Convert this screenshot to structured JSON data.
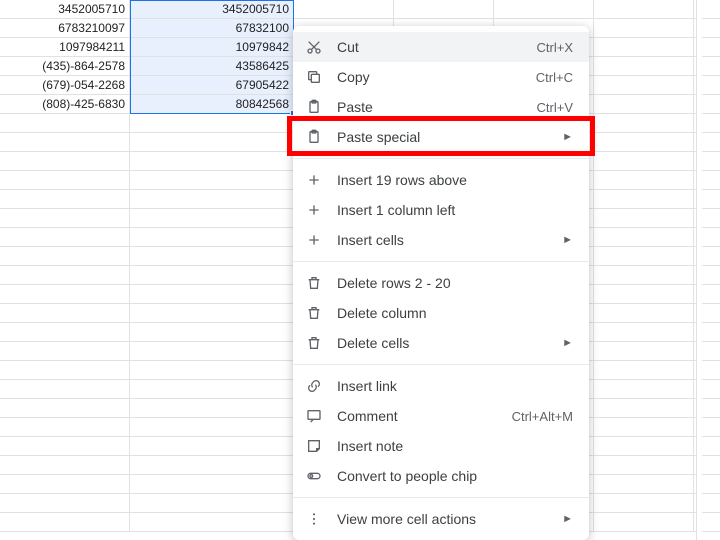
{
  "sheet": {
    "rows": [
      {
        "a": "3452005710",
        "b": "3452005710"
      },
      {
        "a": "6783210097",
        "b": "67832100"
      },
      {
        "a": "1097984211",
        "b": "10979842"
      },
      {
        "a": "(435)-864-2578",
        "b": "43586425"
      },
      {
        "a": "(679)-054-2268",
        "b": "67905422"
      },
      {
        "a": "(808)-425-6830",
        "b": "80842568"
      }
    ]
  },
  "menu": {
    "cut": {
      "label": "Cut",
      "shortcut": "Ctrl+X"
    },
    "copy": {
      "label": "Copy",
      "shortcut": "Ctrl+C"
    },
    "paste": {
      "label": "Paste",
      "shortcut": "Ctrl+V"
    },
    "paste_special": {
      "label": "Paste special"
    },
    "insert_rows": {
      "label": "Insert 19 rows above"
    },
    "insert_col": {
      "label": "Insert 1 column left"
    },
    "insert_cells": {
      "label": "Insert cells"
    },
    "delete_rows": {
      "label": "Delete rows 2 - 20"
    },
    "delete_col": {
      "label": "Delete column"
    },
    "delete_cells": {
      "label": "Delete cells"
    },
    "insert_link": {
      "label": "Insert link"
    },
    "comment": {
      "label": "Comment",
      "shortcut": "Ctrl+Alt+M"
    },
    "insert_note": {
      "label": "Insert note"
    },
    "people_chip": {
      "label": "Convert to people chip"
    },
    "more": {
      "label": "View more cell actions"
    }
  }
}
